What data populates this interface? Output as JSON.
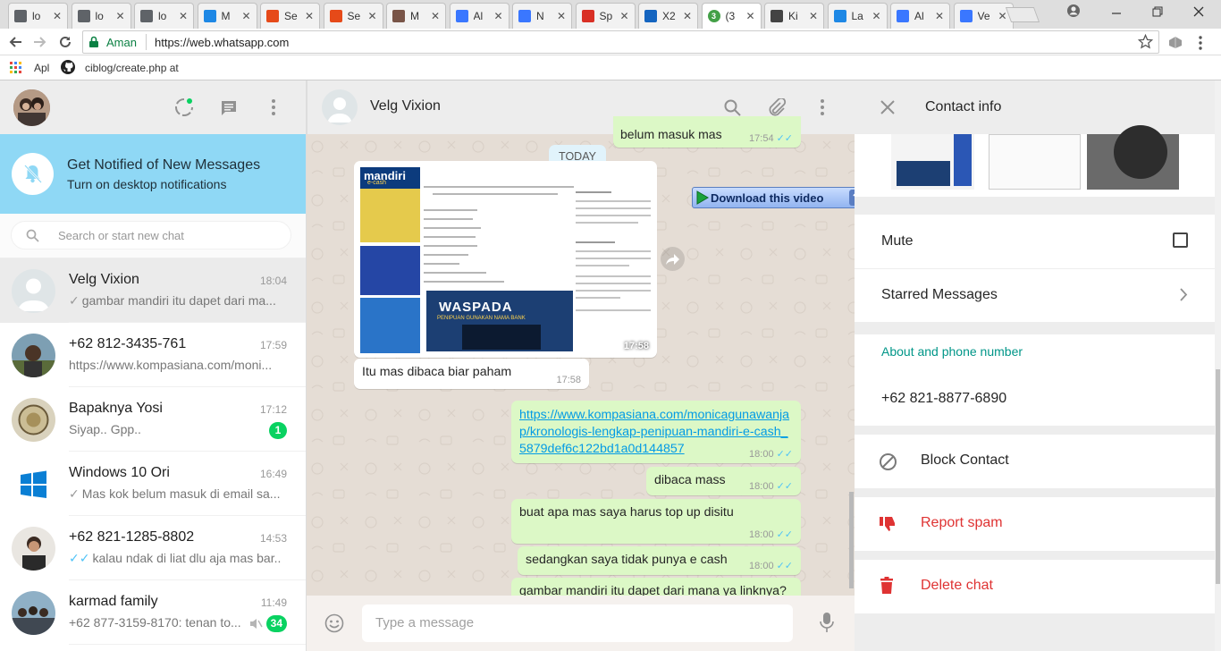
{
  "browser": {
    "tabs": [
      {
        "title": "lo",
        "icon": "doc-icon",
        "color": "#5f6368"
      },
      {
        "title": "lo",
        "icon": "doc-icon",
        "color": "#5f6368"
      },
      {
        "title": "lo",
        "icon": "doc-icon",
        "color": "#5f6368"
      },
      {
        "title": "M",
        "icon": "messenger-icon",
        "color": "#1e88e5"
      },
      {
        "title": "Se",
        "icon": "flame-icon",
        "color": "#e64a19"
      },
      {
        "title": "Se",
        "icon": "flame-icon",
        "color": "#e64a19"
      },
      {
        "title": "M",
        "icon": "avatar-icon",
        "color": "#795548"
      },
      {
        "title": "Al",
        "icon": "olx-icon",
        "color": "#3a77ff"
      },
      {
        "title": "N",
        "icon": "olx-icon",
        "color": "#3a77ff"
      },
      {
        "title": "Sp",
        "icon": "gmail-icon",
        "color": "#d93025"
      },
      {
        "title": "X2",
        "icon": "x-icon",
        "color": "#1565c0"
      },
      {
        "title": "(3",
        "icon": "whatsapp-count-icon",
        "color": "#43a047",
        "active": true
      },
      {
        "title": "Ki",
        "icon": "cat-icon",
        "color": "#444444"
      },
      {
        "title": "La",
        "icon": "check-icon",
        "color": "#1e88e5"
      },
      {
        "title": "Al",
        "icon": "olx-icon",
        "color": "#3a77ff"
      },
      {
        "title": "Ve",
        "icon": "olx-icon",
        "color": "#3a77ff"
      }
    ],
    "active_tab_badge": "3",
    "secure_label": "Aman",
    "url": "https://web.whatsapp.com",
    "bookmarks": [
      {
        "label": "Apl",
        "icon": "apps-grid-icon"
      },
      {
        "label": "ciblog/create.php at",
        "icon": "github-icon"
      }
    ]
  },
  "sidebar": {
    "notification": {
      "title": "Get Notified of New Messages",
      "subtitle": "Turn on desktop notifications"
    },
    "search_placeholder": "Search or start new chat",
    "chats": [
      {
        "name": "Velg Vixion",
        "time": "18:04",
        "preview": "gambar mandiri itu dapet dari ma...",
        "tick": "grey",
        "selected": true,
        "badge": ""
      },
      {
        "name": "+62 812-3435-761",
        "time": "17:59",
        "preview": "https://www.kompasiana.com/moni...",
        "tick": "",
        "selected": false,
        "badge": ""
      },
      {
        "name": "Bapaknya Yosi",
        "time": "17:12",
        "preview": "Siyap.. Gpp..",
        "tick": "",
        "selected": false,
        "badge": "1"
      },
      {
        "name": "Windows 10 Ori",
        "time": "16:49",
        "preview": "Mas kok belum masuk di email sa...",
        "tick": "grey",
        "selected": false,
        "badge": ""
      },
      {
        "name": "+62 821-1285-8802",
        "time": "14:53",
        "preview": "kalau ndak di liat dlu aja mas bar...",
        "tick": "blue",
        "selected": false,
        "badge": ""
      },
      {
        "name": "karmad family",
        "time": "11:49",
        "preview": "+62 877-3159-8170: tenan to...",
        "tick": "",
        "selected": false,
        "badge": "34",
        "muted": true
      }
    ]
  },
  "conversation": {
    "contact_name": "Velg Vixion",
    "date_divider": "TODAY",
    "top_partial": {
      "text": "belum masuk mas",
      "time": "17:54"
    },
    "image_message": {
      "time": "17:58",
      "bank": "mandiri",
      "bank_sub": "e-cash",
      "banner": "WASPADA",
      "banner_sub": "PENIPUAN GUNAKAN NAMA BANK"
    },
    "download_overlay": {
      "label": "Download this video",
      "help": "?",
      "close": "X"
    },
    "messages": [
      {
        "dir": "in",
        "text": "Itu mas dibaca biar paham",
        "time": "17:58"
      },
      {
        "dir": "out",
        "text": "https://www.kompasiana.com/monicagunawanjap/kronologis-lengkap-penipuan-mandiri-e-cash_5879def6c122bd1a0d144857",
        "time": "18:00",
        "link": true
      },
      {
        "dir": "out",
        "text": "dibaca mass",
        "time": "18:00"
      },
      {
        "dir": "out",
        "text": "buat apa mas saya harus top up disitu",
        "time": "18:00"
      },
      {
        "dir": "out",
        "text": "sedangkan saya tidak punya e cash",
        "time": "18:00"
      },
      {
        "dir": "out",
        "text": "gambar mandiri itu dapet dari mana ya linknya?",
        "time": "18:04"
      }
    ],
    "composer_placeholder": "Type a message"
  },
  "contact_info": {
    "title": "Contact info",
    "mute_label": "Mute",
    "starred_label": "Starred Messages",
    "about_heading": "About and phone number",
    "phone": "+62 821-8877-6890",
    "block_label": "Block Contact",
    "report_label": "Report spam",
    "delete_label": "Delete chat"
  },
  "colors": {
    "accent_teal": "#009688",
    "danger": "#df3333",
    "bubble_out": "#dcf8c6",
    "notify_banner": "#8fd8f5",
    "badge_green": "#09d261",
    "link": "#039be5"
  }
}
